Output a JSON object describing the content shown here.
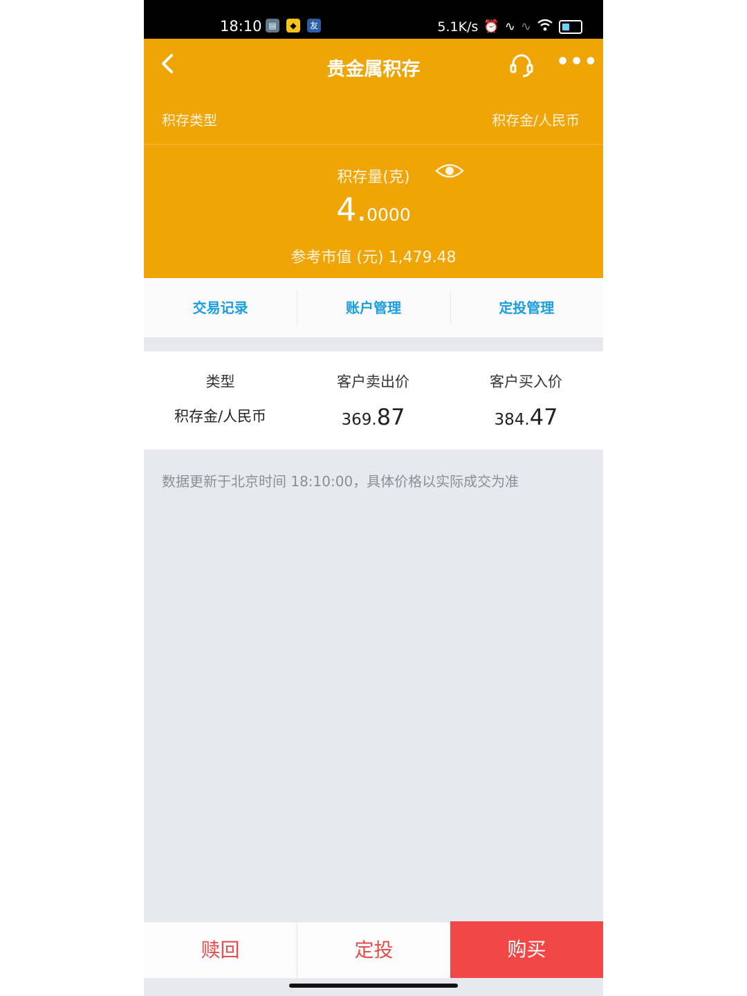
{
  "status_bar": {
    "time": "18:10",
    "network_speed": "5.1K/s",
    "app_icons": [
      "sim-card-icon",
      "app-icon",
      "weibo-icon"
    ],
    "right_icons": [
      "alarm-icon",
      "signal-icon",
      "signal-weak-icon",
      "wifi-icon",
      "battery-icon"
    ]
  },
  "nav": {
    "title": "贵金属积存",
    "more_glyph": "•••"
  },
  "account": {
    "type_label": "积存类型",
    "type_value": "积存金/人民币",
    "qty_label": "积存量(克)",
    "qty_int": "4.",
    "qty_dec": "0000",
    "ref_value": "参考市值 (元) 1,479.48"
  },
  "tabs": [
    {
      "label": "交易记录"
    },
    {
      "label": "账户管理"
    },
    {
      "label": "定投管理"
    }
  ],
  "prices": {
    "headers": [
      "类型",
      "客户卖出价",
      "客户买入价"
    ],
    "type": "积存金/人民币",
    "sell_int": "369.",
    "sell_dec": "87",
    "buy_int": "384.",
    "buy_dec": "47"
  },
  "note": "数据更新于北京时间 18:10:00，具体价格以实际成交为准",
  "bottom": {
    "redeem": "赎回",
    "fixed": "定投",
    "buy": "购买"
  },
  "colors": {
    "header": "#f0a507",
    "tab_text": "#1a9ee0",
    "buy": "#f14747",
    "sell_text": "#e84b4b"
  }
}
